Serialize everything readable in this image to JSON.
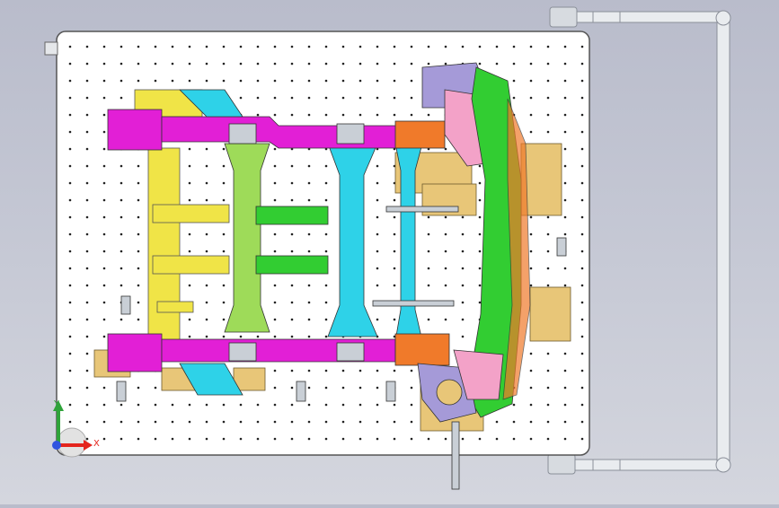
{
  "viewport": {
    "background_top": "#b9bccb",
    "background_bottom": "#d4d6de",
    "plate_color": "#ffffff",
    "hole_color": "#222222"
  },
  "triad": {
    "y_label": "Y",
    "x_label": "X",
    "x_color": "#e4251d",
    "y_color": "#2fa33a",
    "z_color": "#2f54e0"
  },
  "colors": {
    "frame_rail": "#e21fd6",
    "cross_member_cyan": "#2ed2e8",
    "cross_member_lightgreen": "#9edb59",
    "cross_member_yellow": "#f0e447",
    "bracket_green": "#32cd32",
    "bracket_orange": "#f07a2a",
    "bracket_violet": "#a59ad8",
    "bracket_pink": "#f3a2c8",
    "tan_plate": "#e8c678",
    "steel": "#c9cfd6"
  }
}
